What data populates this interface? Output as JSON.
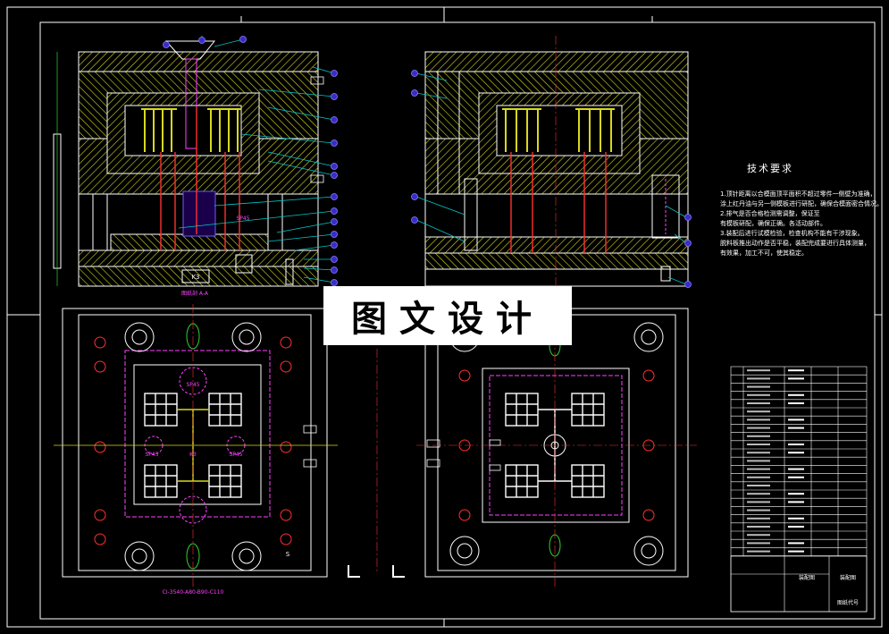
{
  "watermark": "图文设计",
  "technical_requirements": {
    "title": "技术要求",
    "lines": [
      "1.顶针距离以合模面顶平面积不超过零件一侧壁为准确，",
      "  涂上红丹油与另一侧模板进行研配，确保合模面密合情况。",
      "2.排气是否合格检测需调整，保证至",
      "  有模板研配，确保正确。各活动部件。",
      "3.装配后进行试模检验，检查机构不能有干涉现象。",
      "  脱料板推出动作是否平稳，装配完成要进行具体测量，",
      "  有效果，加工不可，使其稳定。"
    ]
  },
  "annotations": {
    "top_left_label": "K3",
    "top_left_dim": "SP45",
    "section_mark": "图纸剖 A-A",
    "plan_part_number": "CI-3540-A80-B90-C110",
    "plan_label_1": "SP45",
    "plan_label_2": "SP45",
    "plan_label_3": "K3",
    "plan_label_4": "SP45",
    "plan_label_5": "S"
  },
  "title_block": {
    "field_1": "装配图",
    "field_2": "装配图",
    "field_3": "图纸代号"
  },
  "colors": {
    "background": "#000000",
    "outline": "#ffffff",
    "hatch": "#d8d820",
    "leader": "#00c8c8",
    "balloon": "#6a5cff",
    "pin": "#ff3030",
    "magenta": "#ff40ff",
    "green": "#30d030",
    "center_line": "#ff3030"
  }
}
